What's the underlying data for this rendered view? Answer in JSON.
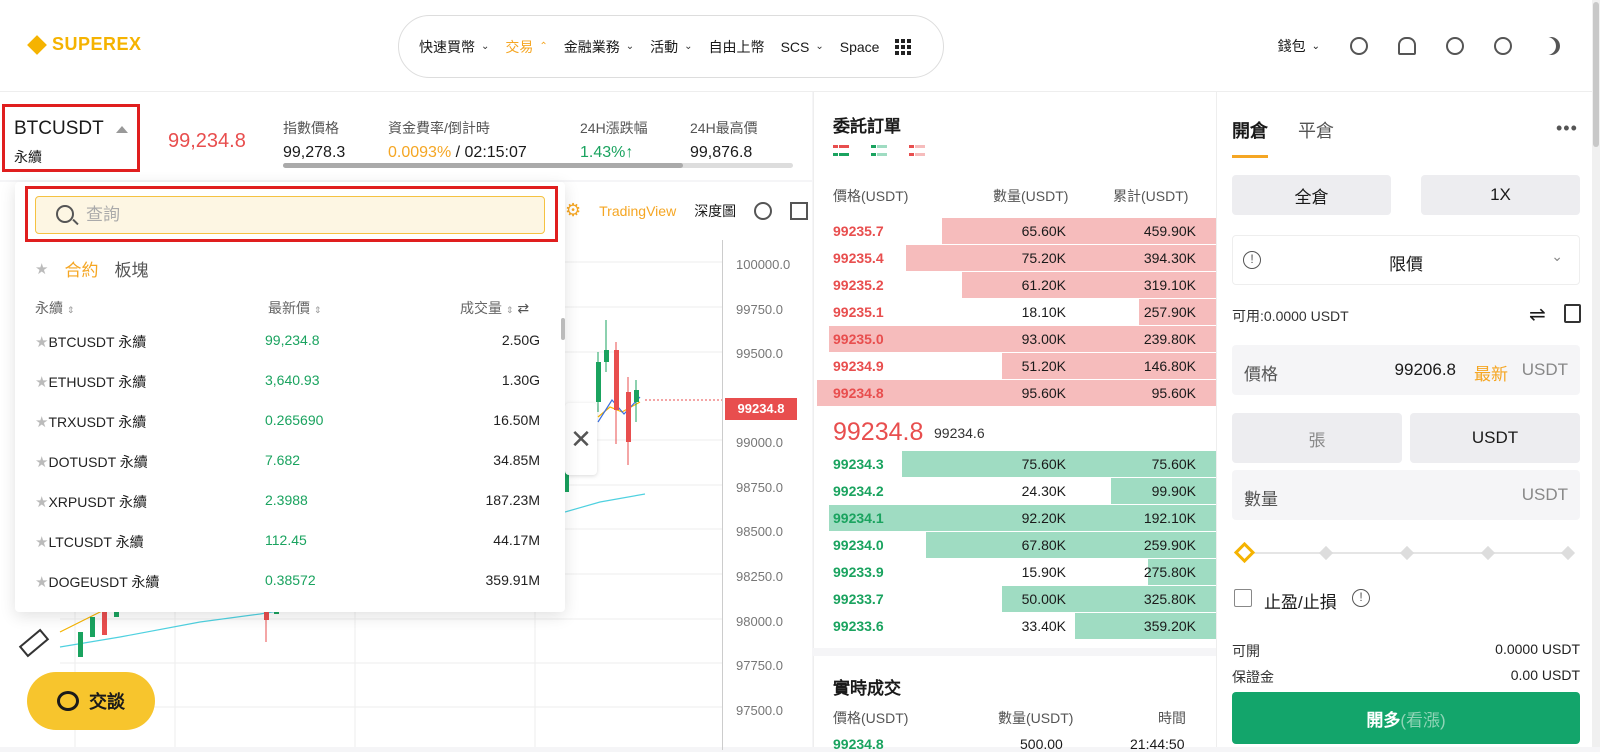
{
  "header": {
    "logo": "SUPEREX",
    "nav": [
      {
        "label": "快速買幣",
        "chevron": true,
        "active": false
      },
      {
        "label": "交易",
        "chevron": true,
        "active": true
      },
      {
        "label": "金融業務",
        "chevron": true,
        "active": false
      },
      {
        "label": "活動",
        "chevron": true,
        "active": false
      },
      {
        "label": "自由上幣",
        "chevron": false,
        "active": false
      },
      {
        "label": "SCS",
        "chevron": true,
        "active": false
      },
      {
        "label": "Space",
        "chevron": false,
        "active": false
      }
    ],
    "wallet": "錢包"
  },
  "ticker": {
    "symbol": "BTCUSDT",
    "symbol_sub": "永續",
    "last_price": "99,234.8",
    "index_label": "指數價格",
    "index_value": "99,278.3",
    "funding_label": "資金費率/倒計時",
    "funding_rate": "0.0093%",
    "funding_sep": " / ",
    "funding_countdown": "02:15:07",
    "change_label": "24H漲跌幅",
    "change_value": "1.43%↑",
    "high_label": "24H最高價",
    "high_value": "99,876.8"
  },
  "chart_toolbar": {
    "tradingview": "TradingView",
    "depth": "深度圖"
  },
  "chart": {
    "y_labels": [
      "100000.0",
      "99750.0",
      "99500.0",
      "99000.0",
      "98750.0",
      "98500.0",
      "98250.0",
      "98000.0",
      "97750.0",
      "97500.0"
    ],
    "price_tag": "99234.8"
  },
  "dropdown": {
    "search_placeholder": "查詢",
    "tab_contract": "合約",
    "tab_sector": "板塊",
    "col_name": "永續",
    "col_price": "最新價",
    "col_volume": "成交量",
    "rows": [
      {
        "name": "BTCUSDT 永續",
        "price": "99,234.8",
        "volume": "2.50G"
      },
      {
        "name": "ETHUSDT 永續",
        "price": "3,640.93",
        "volume": "1.30G"
      },
      {
        "name": "TRXUSDT 永續",
        "price": "0.265690",
        "volume": "16.50M"
      },
      {
        "name": "DOTUSDT 永續",
        "price": "7.682",
        "volume": "34.85M"
      },
      {
        "name": "XRPUSDT 永續",
        "price": "2.3988",
        "volume": "187.23M"
      },
      {
        "name": "LTCUSDT 永續",
        "price": "112.45",
        "volume": "44.17M"
      },
      {
        "name": "DOGEUSDT 永續",
        "price": "0.38572",
        "volume": "359.91M"
      }
    ]
  },
  "chat": {
    "label": "交談"
  },
  "orderbook": {
    "title": "委託訂單",
    "col_price": "價格(USDT)",
    "col_qty": "數量(USDT)",
    "col_total": "累計(USDT)",
    "asks": [
      {
        "price": "99235.7",
        "qty": "65.60K",
        "total": "459.90K",
        "depth": 0.68
      },
      {
        "price": "99235.4",
        "qty": "75.20K",
        "total": "394.30K",
        "depth": 0.77
      },
      {
        "price": "99235.2",
        "qty": "61.20K",
        "total": "319.10K",
        "depth": 0.63
      },
      {
        "price": "99235.1",
        "qty": "18.10K",
        "total": "257.90K",
        "depth": 0.19
      },
      {
        "price": "99235.0",
        "qty": "93.00K",
        "total": "239.80K",
        "depth": 0.96
      },
      {
        "price": "99234.9",
        "qty": "51.20K",
        "total": "146.80K",
        "depth": 0.53
      },
      {
        "price": "99234.8",
        "qty": "95.60K",
        "total": "95.60K",
        "depth": 0.99
      }
    ],
    "mid_price": "99234.8",
    "mid_index": "99234.6",
    "bids": [
      {
        "price": "99234.3",
        "qty": "75.60K",
        "total": "75.60K",
        "depth": 0.78
      },
      {
        "price": "99234.2",
        "qty": "24.30K",
        "total": "99.90K",
        "depth": 0.26
      },
      {
        "price": "99234.1",
        "qty": "92.20K",
        "total": "192.10K",
        "depth": 0.96
      },
      {
        "price": "99234.0",
        "qty": "67.80K",
        "total": "259.90K",
        "depth": 0.72
      },
      {
        "price": "99233.9",
        "qty": "15.90K",
        "total": "275.80K",
        "depth": 0.17
      },
      {
        "price": "99233.7",
        "qty": "50.00K",
        "total": "325.80K",
        "depth": 0.53
      },
      {
        "price": "99233.6",
        "qty": "33.40K",
        "total": "359.20K",
        "depth": 0.35
      }
    ],
    "trades_title": "實時成交",
    "trades_col_price": "價格(USDT)",
    "trades_col_qty": "數量(USDT)",
    "trades_col_time": "時間",
    "trade_first": {
      "price": "99234.8",
      "qty": "500.00",
      "time": "21:44:50"
    }
  },
  "trade_panel": {
    "tab_open": "開倉",
    "tab_close": "平倉",
    "margin_mode": "全倉",
    "leverage": "1X",
    "order_type": "限價",
    "available": "可用:0.0000 USDT",
    "price_label": "價格",
    "price_value": "99206.8",
    "latest": "最新",
    "unit": "USDT",
    "unit_contracts": "張",
    "unit_usdt": "USDT",
    "qty_label": "數量",
    "tpsl_label": "止盈/止損",
    "can_open_label": "可開",
    "can_open_value": "0.0000 USDT",
    "margin_label": "保證金",
    "margin_value": "0.00 USDT",
    "buy_label": "開多",
    "buy_sub": "(看漲)"
  },
  "colors": {
    "accent": "#f5a623",
    "up": "#1aa35f",
    "down": "#e84e4e",
    "buy": "#13a56b"
  }
}
